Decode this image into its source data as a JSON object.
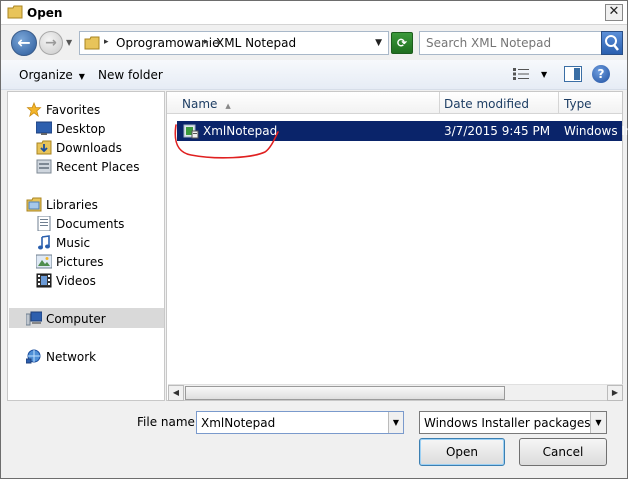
{
  "window": {
    "title": "Open",
    "close_label": "✕"
  },
  "nav": {
    "breadcrumb": [
      "Oprogramowanie",
      "XML Notepad"
    ],
    "search_placeholder": "Search XML Notepad"
  },
  "toolbar": {
    "organize_label": "Organize",
    "new_folder_label": "New folder",
    "help_label": "?"
  },
  "sidebar": {
    "favorites": {
      "label": "Favorites",
      "items": [
        "Desktop",
        "Downloads",
        "Recent Places"
      ]
    },
    "libraries": {
      "label": "Libraries",
      "items": [
        "Documents",
        "Music",
        "Pictures",
        "Videos"
      ]
    },
    "computer_label": "Computer",
    "network_label": "Network",
    "selected": "Computer"
  },
  "file_list": {
    "columns": [
      "Name",
      "Date modified",
      "Type"
    ],
    "rows": [
      {
        "name": "XmlNotepad",
        "date_modified": "3/7/2015 9:45 PM",
        "type": "Windows Ins",
        "selected": true
      }
    ]
  },
  "footer": {
    "file_name_label": "File name:",
    "file_name_value": "XmlNotepad",
    "file_type_filter": "Windows Installer packages (*.r",
    "open_label": "Open",
    "cancel_label": "Cancel"
  },
  "colors": {
    "selection": "#0a246a",
    "annotation": "#e02020"
  }
}
